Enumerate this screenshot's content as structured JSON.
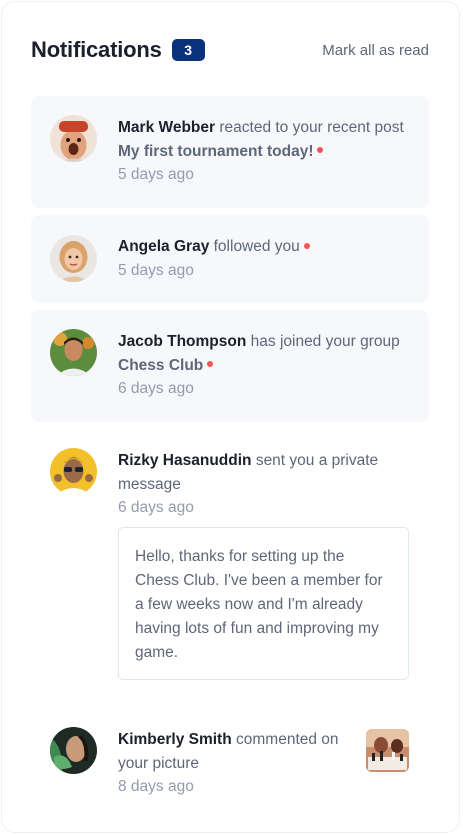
{
  "header": {
    "title": "Notifications",
    "unread_count": "3",
    "mark_all_label": "Mark all as read"
  },
  "notifications": [
    {
      "name": "Mark Webber",
      "action": "reacted to your recent post",
      "target": "My first tournament today!",
      "time": "5 days ago",
      "unread": true,
      "avatar": "avatar-mark-webber"
    },
    {
      "name": "Angela Gray",
      "action": "followed you",
      "time": "5 days ago",
      "unread": true,
      "avatar": "avatar-angela-gray"
    },
    {
      "name": "Jacob Thompson",
      "action": "has joined your group",
      "target": "Chess Club",
      "time": "6 days ago",
      "unread": true,
      "avatar": "avatar-jacob-thompson"
    },
    {
      "name": "Rizky Hasanuddin",
      "action": "sent you a private message",
      "time": "6 days ago",
      "unread": false,
      "avatar": "avatar-rizky-hasanuddin",
      "message": "Hello, thanks for setting up the Chess Club. I've been a member for a few weeks now and I'm already having lots of fun and improving my game."
    },
    {
      "name": "Kimberly Smith",
      "action": "commented on your picture",
      "time": "8 days ago",
      "unread": false,
      "avatar": "avatar-kimberly-smith",
      "picture": "chess-picture-thumbnail"
    }
  ],
  "colors": {
    "unread_bg": "#f6f8fc",
    "badge": "#0a327b",
    "dot": "#f65552",
    "heading": "#1c202b",
    "text": "#5e6778",
    "muted": "#939cad"
  }
}
